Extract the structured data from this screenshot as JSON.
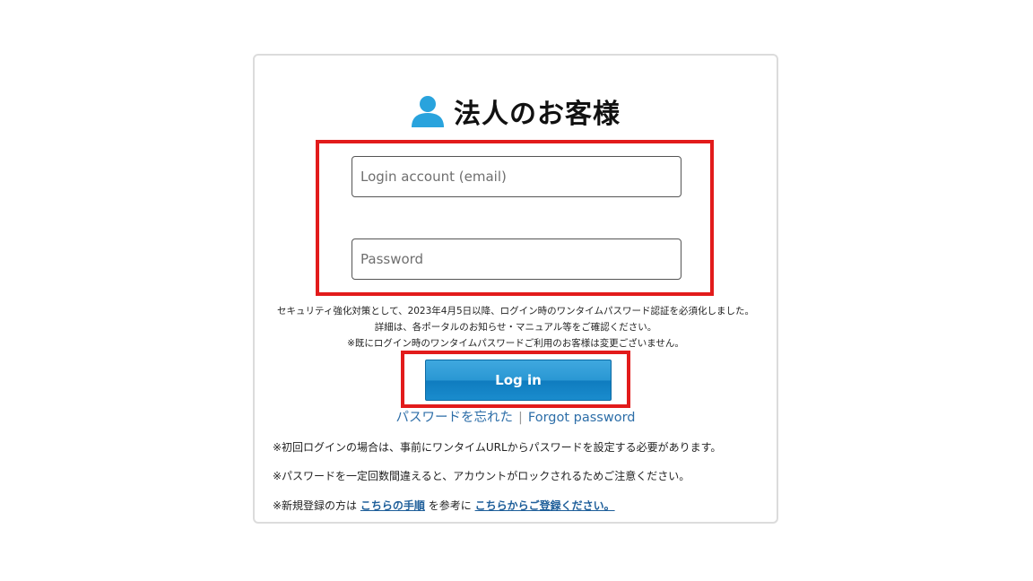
{
  "header": {
    "title": "法人のお客様",
    "icon": "user-icon"
  },
  "form": {
    "email_placeholder": "Login account (email)",
    "password_placeholder": "Password",
    "login_label": "Log in"
  },
  "notice": {
    "line1": "セキュリティ強化対策として、2023年4月5日以降、ログイン時のワンタイムパスワード認証を必須化しました。",
    "line2": "詳細は、各ポータルのお知らせ・マニュアル等をご確認ください。",
    "line3": "※既にログイン時のワンタイムパスワードご利用のお客様は変更ございません。"
  },
  "forgot": {
    "jp_label": "パスワードを忘れた",
    "separator": "|",
    "en_label": "Forgot password"
  },
  "notes": {
    "first_login": "※初回ログインの場合は、事前にワンタイムURLからパスワードを設定する必要があります。",
    "lock_warning": "※パスワードを一定回数間違えると、アカウントがロックされるためご注意ください。",
    "register_prefix": "※新規登録の方は",
    "register_link1": "こちらの手順",
    "register_middle": "を参考に",
    "register_link2": "こちらからご登録ください。"
  },
  "colors": {
    "highlight": "#e21b1b",
    "button": "#2a97d3",
    "link": "#2d6ea8",
    "icon": "#29a3dd"
  }
}
